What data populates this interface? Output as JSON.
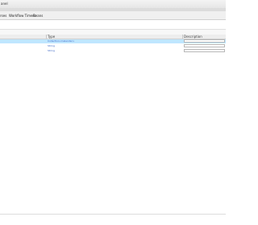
{
  "window": {
    "title": "anel"
  },
  "menu": {
    "items": [
      {
        "label": "rses"
      },
      {
        "label": "Workflow Timers"
      },
      {
        "label": "Beans"
      }
    ]
  },
  "table": {
    "columns": [
      {
        "label": ""
      },
      {
        "label": "Type"
      },
      {
        "label": "Description"
      }
    ],
    "rows": [
      {
        "name": "",
        "type": "Collection<Calendar>",
        "selected": true
      },
      {
        "name": "",
        "type": "String",
        "selected": false
      },
      {
        "name": "",
        "type": "String",
        "selected": false
      }
    ]
  }
}
